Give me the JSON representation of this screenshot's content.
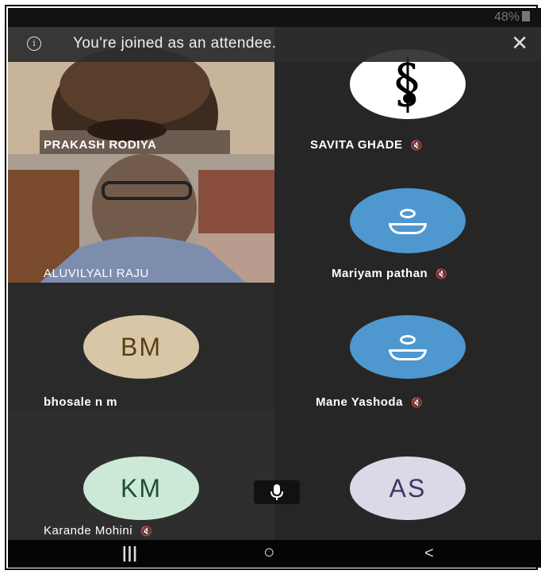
{
  "status": {
    "battery": "48%"
  },
  "banner": {
    "message": "You're joined as an attendee.",
    "close": "✕",
    "info": "i"
  },
  "participants": [
    {
      "name": "PRAKASH RODIYA",
      "muted": false,
      "type": "video"
    },
    {
      "name": "SAVITA GHADE",
      "muted": true,
      "type": "logo"
    },
    {
      "name": "ALUVILYALI RAJU",
      "muted": false,
      "type": "video"
    },
    {
      "name": "Mariyam pathan",
      "muted": true,
      "type": "person-icon"
    },
    {
      "name": "bhosale n m",
      "muted": false,
      "initials": "BM",
      "type": "initials"
    },
    {
      "name": "Mane Yashoda",
      "muted": true,
      "type": "person-icon"
    },
    {
      "name": "Karande Mohini",
      "muted": true,
      "initials": "KM",
      "type": "initials"
    },
    {
      "name": "",
      "muted": false,
      "initials": "AS",
      "type": "initials"
    }
  ],
  "icons": {
    "mute": "muted-mic-icon",
    "mic": "microphone-icon"
  },
  "navbar": {
    "recents": "|||",
    "home": "○",
    "back": "<"
  },
  "colors": {
    "accent_blue": "#4f97cf",
    "bm_bg": "#d8c7a7",
    "bm_fg": "#5a3f12",
    "km_bg": "#cbe9d6",
    "km_fg": "#1f4e34",
    "as_bg": "#ddd8e7",
    "as_fg": "#3c3a63"
  }
}
